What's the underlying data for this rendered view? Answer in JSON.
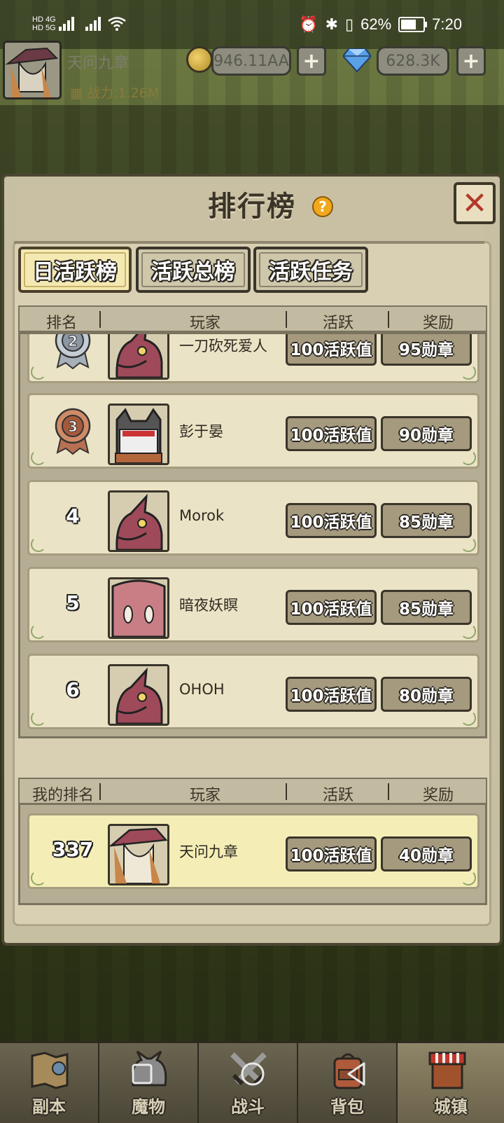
{
  "status_bar": {
    "network_left": "HD 4G",
    "network_right": "HD 5G",
    "battery": "62%",
    "time": "7:20"
  },
  "header": {
    "player_name": "天问九章",
    "power": "战力:1.26M",
    "gold": "946.11AA",
    "diamonds": "628.3K",
    "gold_plus": "+",
    "diamond_plus": "+"
  },
  "panel": {
    "title": "排行榜",
    "help": "?",
    "close": "✕",
    "tabs": [
      {
        "label": "日活跃榜",
        "active": true
      },
      {
        "label": "活跃总榜",
        "active": false
      },
      {
        "label": "活跃任务",
        "active": false
      }
    ],
    "table_headers": {
      "rank": "排名",
      "player": "玩家",
      "activity": "活跃",
      "reward": "奖励"
    },
    "rows": [
      {
        "rank": "2",
        "medal": "silver",
        "name": "一刀砍死爱人",
        "activity": "100活跃值",
        "reward": "95勋章",
        "avatar": "lizard"
      },
      {
        "rank": "3",
        "medal": "bronze",
        "name": "彭于晏",
        "activity": "100活跃值",
        "reward": "90勋章",
        "avatar": "cat"
      },
      {
        "rank": "4",
        "medal": "",
        "name": "Morok",
        "activity": "100活跃值",
        "reward": "85勋章",
        "avatar": "lizard"
      },
      {
        "rank": "5",
        "medal": "",
        "name": "暗夜妖瞑",
        "activity": "100活跃值",
        "reward": "85勋章",
        "avatar": "blob"
      },
      {
        "rank": "6",
        "medal": "",
        "name": "OHOH",
        "activity": "100活跃值",
        "reward": "80勋章",
        "avatar": "lizard"
      }
    ],
    "my_headers": {
      "rank": "我的排名",
      "player": "玩家",
      "activity": "活跃",
      "reward": "奖励"
    },
    "my_row": {
      "rank": "337",
      "name": "天问九章",
      "activity": "100活跃值",
      "reward": "40勋章"
    }
  },
  "bottom_nav": [
    {
      "label": "副本",
      "active": false
    },
    {
      "label": "魔物",
      "active": false
    },
    {
      "label": "战斗",
      "active": false
    },
    {
      "label": "背包",
      "active": false
    },
    {
      "label": "城镇",
      "active": true
    }
  ],
  "colors": {
    "accent": "#f0a81c",
    "close": "#b3382c",
    "active_tab": "#f4e9b2"
  }
}
